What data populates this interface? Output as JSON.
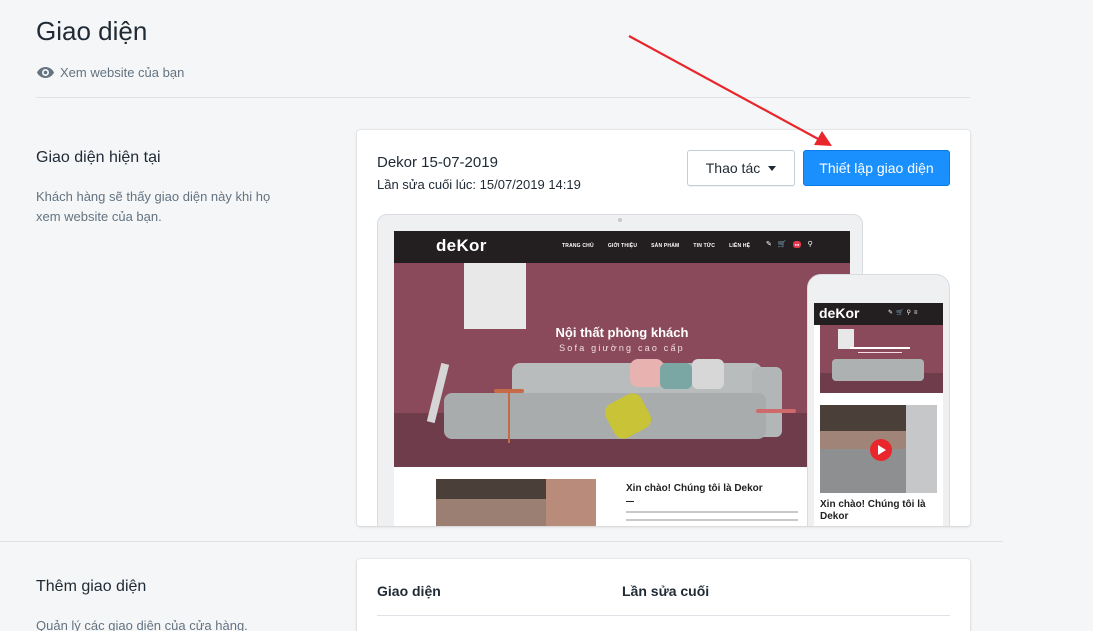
{
  "header": {
    "title": "Giao diện",
    "view_link": "Xem website của bạn"
  },
  "current_theme": {
    "heading": "Giao diện hiện tại",
    "description": "Khách hàng sẽ thấy giao diện này khi họ xem website của bạn.",
    "theme_name": "Dekor 15-07-2019",
    "last_edited": "Lần sửa cuối lúc: 15/07/2019 14:19",
    "actions_label": "Thao tác",
    "customize_label": "Thiết lập giao diện"
  },
  "preview": {
    "logo": "deKor",
    "menu": [
      "TRANG CHỦ",
      "GIỚI THIỆU",
      "SẢN PHẨM",
      "TIN TỨC",
      "LIÊN HỆ"
    ],
    "hero_title": "Nội thất phòng khách",
    "hero_subtitle": "Sofa giường cao cấp",
    "welcome": "Xin chào! Chúng tôi là Dekor",
    "mobile_welcome": "Xin chào! Chúng tôi là Dekor"
  },
  "more_themes": {
    "heading": "Thêm giao diện",
    "description": "Quản lý các giao diện của cửa hàng.",
    "col_theme": "Giao diện",
    "col_last_edit": "Lần sửa cuối"
  },
  "colors": {
    "primary": "#1a90ff",
    "annotation_arrow": "#e8262b"
  }
}
